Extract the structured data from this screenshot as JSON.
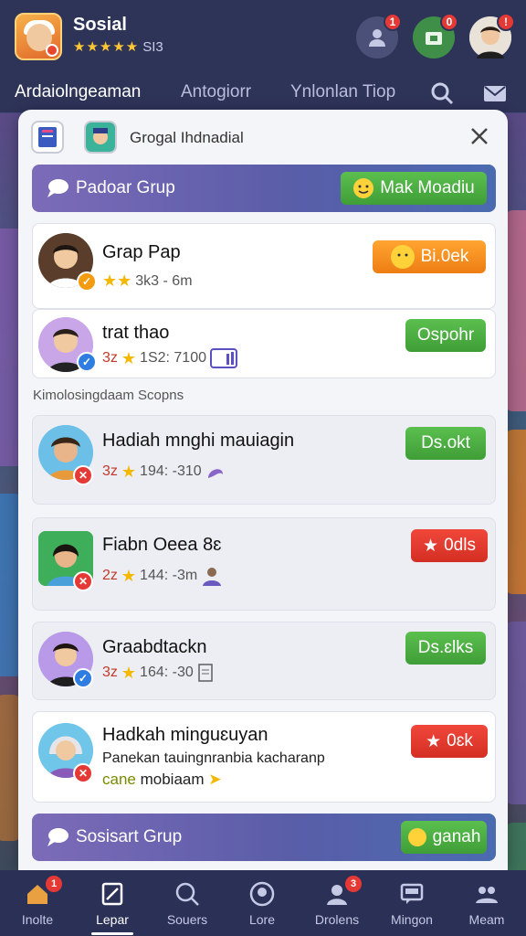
{
  "app": {
    "title": "Sosial",
    "stars": "★★★★★",
    "rating_text": "SI3"
  },
  "top_actions": [
    {
      "icon": "user-icon",
      "badge": "1"
    },
    {
      "icon": "shop-icon",
      "badge": "0"
    },
    {
      "icon": "profile-avatar",
      "badge": "!"
    }
  ],
  "nav": {
    "tabs": [
      "Ardaiolngeaman",
      "Antogiorr",
      "Ynlonlan Tiop"
    ],
    "icons": [
      "search-icon",
      "mail-icon"
    ]
  },
  "panel": {
    "title": "Grogal Ihdnadial",
    "close_icon": "close-icon",
    "top_banner": {
      "label": "Padoar Grup",
      "button": "Mak Moadiu"
    },
    "section_label": "Kimolosingdaam Scopns",
    "bottom_banner": {
      "label": "Sosisart Grup",
      "button": "ganah"
    }
  },
  "featured": [
    {
      "name": "Grap Pap",
      "meta": "3k3 - 6m",
      "button": "Bi.0ek",
      "button_color": "orange"
    },
    {
      "name": "trat thao",
      "level": "3z",
      "meta": "1S2: 7100",
      "button": "Ospohr",
      "button_color": "green"
    }
  ],
  "groups": [
    {
      "name": "Hadiah mnghi mauiagin",
      "level": "3z",
      "meta": "194: -310",
      "button": "Ds.okt",
      "button_color": "green"
    },
    {
      "name": "Fiabn Oeea 8ɛ",
      "level": "2z",
      "meta": "144: -3m",
      "button": "0dls",
      "button_color": "red"
    },
    {
      "name": "Graabdtackn",
      "level": "3z",
      "meta": "164: -30",
      "button": "Ds.ɛlks",
      "button_color": "green"
    },
    {
      "name": "Hadkah minguɛuyan",
      "desc": "Panekan tauingnranbia kacharanp",
      "sub_hl": "cane",
      "sub": "mobiaam",
      "button": "0ɛk",
      "button_color": "red"
    }
  ],
  "bottom_nav": [
    {
      "label": "Inolte",
      "icon": "home-icon",
      "badge": "1"
    },
    {
      "label": "Lepar",
      "icon": "edit-icon",
      "active": true
    },
    {
      "label": "Souers",
      "icon": "search-icon"
    },
    {
      "label": "Lore",
      "icon": "profile-icon"
    },
    {
      "label": "Drolens",
      "icon": "friends-icon",
      "badge": "3"
    },
    {
      "label": "Mingon",
      "icon": "chat-icon"
    },
    {
      "label": "Meam",
      "icon": "team-icon"
    }
  ],
  "colors": {
    "nav_bg": "#2e3358",
    "panel_bg": "#f4f5f8",
    "green": "#4caf46",
    "orange": "#f7901f",
    "red": "#e33b2e",
    "banner": "#6b62b4"
  }
}
